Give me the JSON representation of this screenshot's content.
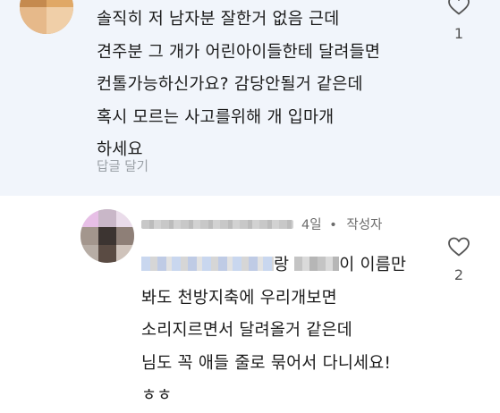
{
  "comment1": {
    "lines": [
      "솔직히 저 남자분 잘한거 없음 근데",
      "견주분 그 개가 어린아이들한테 달려들면",
      "컨톨가능하신가요? 감당안될거 같은데",
      "혹시 모르는 사고를위해 개 입마개",
      "하세요"
    ],
    "reply_label": "답글 달기",
    "like_count": "1",
    "like_icon": "heart-outline-icon"
  },
  "comment2": {
    "time": "4일",
    "separator": "•",
    "author_badge": "작성자",
    "line1_a": "랑",
    "line1_b": "이 이름만",
    "lines": [
      "봐도 천방지축에 우리개보면",
      "소리지르면서 달려올거 같은데",
      "님도 꼭 애들 줄로 묶어서 다니세요!",
      "ㅎㅎ"
    ],
    "like_count": "2",
    "like_icon": "heart-outline-icon"
  }
}
